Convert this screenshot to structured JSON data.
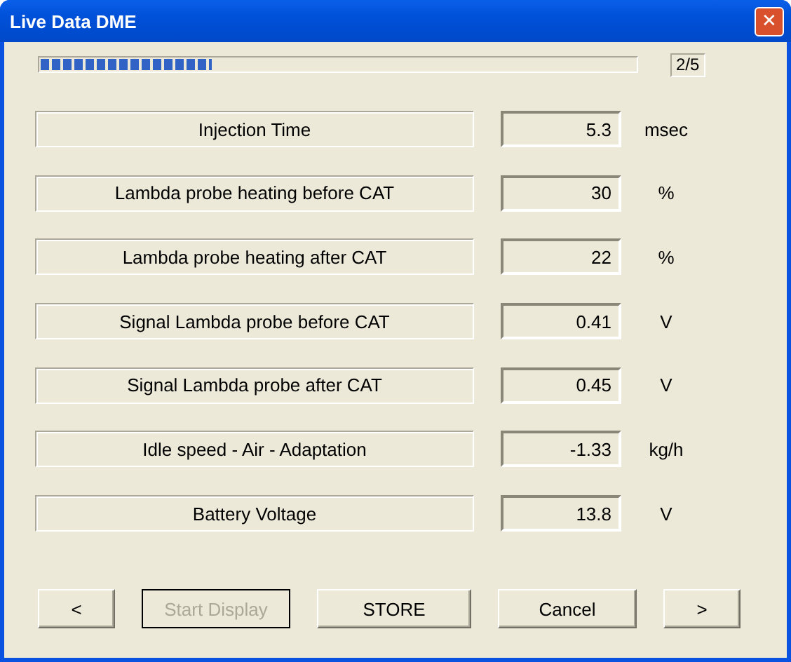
{
  "window": {
    "title": "Live Data DME",
    "close": "✕"
  },
  "progress": {
    "level": 0.29,
    "page": "2/5"
  },
  "rows": [
    {
      "label": "Injection Time",
      "value": "5.3",
      "unit": "msec"
    },
    {
      "label": "Lambda probe heating before CAT",
      "value": "30",
      "unit": "%"
    },
    {
      "label": "Lambda probe heating after CAT",
      "value": "22",
      "unit": "%"
    },
    {
      "label": "Signal Lambda probe before CAT",
      "value": "0.41",
      "unit": "V"
    },
    {
      "label": "Signal Lambda probe after CAT",
      "value": "0.45",
      "unit": "V"
    },
    {
      "label": "Idle speed - Air - Adaptation",
      "value": "-1.33",
      "unit": "kg/h"
    },
    {
      "label": "Battery Voltage",
      "value": "13.8",
      "unit": "V"
    }
  ],
  "buttons": [
    {
      "label": "<",
      "kind": "prev",
      "disabled": false
    },
    {
      "label": "Start Display",
      "kind": "start",
      "disabled": true
    },
    {
      "label": "STORE",
      "kind": "store",
      "disabled": false
    },
    {
      "label": "Cancel",
      "kind": "cancel",
      "disabled": false
    },
    {
      "label": ">",
      "kind": "next",
      "disabled": false
    }
  ]
}
